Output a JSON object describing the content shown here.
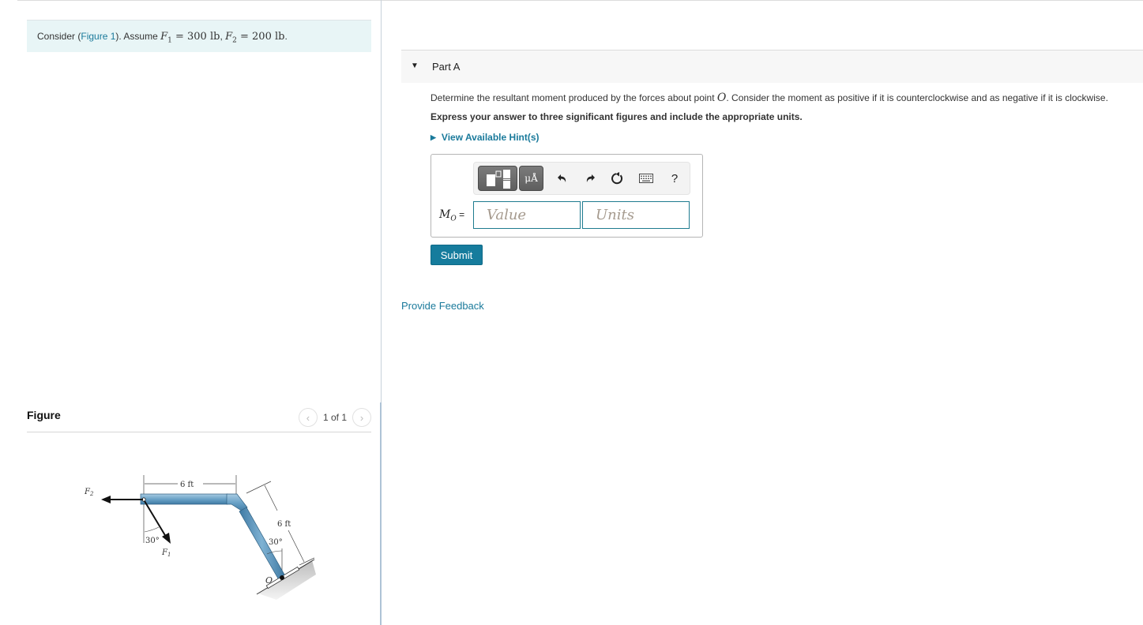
{
  "problem": {
    "prefix": "Consider (",
    "figure_link": "Figure 1",
    "middle": "). Assume ",
    "f1_symbol": "F",
    "f1_sub": "1",
    "f1_value": " = 300 lb",
    "separator": ", ",
    "f2_symbol": "F",
    "f2_sub": "2",
    "f2_value": " = 200 lb",
    "suffix": "."
  },
  "figure_panel": {
    "title": "Figure",
    "pager_text": "1 of 1",
    "prev_icon": "chevron-left-icon",
    "next_icon": "chevron-right-icon",
    "labels": {
      "f1": "F",
      "f1_sub": "1",
      "f2": "F",
      "f2_sub": "2",
      "horizontal_length": "6 ft",
      "inclined_length": "6 ft",
      "angle_f1": "30°",
      "angle_arm": "30°",
      "point": "O"
    }
  },
  "part": {
    "caret_icon": "caret-down-icon",
    "title": "Part A",
    "question_before": "Determine the resultant moment produced by the forces about point ",
    "question_point": "O",
    "question_after": ". Consider the moment as positive if it is counterclockwise and as negative if it is clockwise.",
    "instruction": "Express your answer to three significant figures and include the appropriate units.",
    "hints_label": "View Available Hint(s)"
  },
  "answer": {
    "toolbar": {
      "template_icon": "templates-icon",
      "units_label": "μÅ",
      "undo_icon": "undo-icon",
      "redo_icon": "redo-icon",
      "reset_icon": "reset-icon",
      "keyboard_icon": "keyboard-icon",
      "help_label": "?"
    },
    "variable": "M",
    "variable_sub": "O",
    "equals": " =",
    "value": "",
    "value_placeholder": "Value",
    "units": "",
    "units_placeholder": "Units",
    "submit_label": "Submit"
  },
  "footer": {
    "feedback_label": "Provide Feedback"
  },
  "colors": {
    "accent": "#167c9d",
    "link": "#1a7a9b",
    "intro_bg": "#e8f5f6",
    "part_header_bg": "#f7f7f7",
    "input_border": "#1e7b8f"
  }
}
